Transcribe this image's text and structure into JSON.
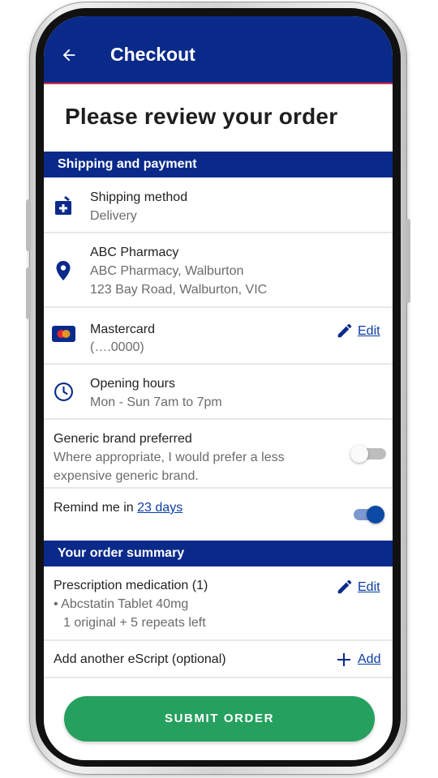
{
  "appbar": {
    "title": "Checkout"
  },
  "page": {
    "title": "Please review your order"
  },
  "sections": {
    "shipping_payment": "Shipping and payment",
    "order_summary": "Your order summary"
  },
  "shipping": {
    "title": "Shipping method",
    "value": "Delivery"
  },
  "pharmacy": {
    "name": "ABC Pharmacy",
    "line1": "ABC Pharmacy, Walburton",
    "line2": "123 Bay Road, Walburton, VIC"
  },
  "payment": {
    "card": "Mastercard",
    "number": "(….0000)",
    "edit": "Edit"
  },
  "hours": {
    "title": "Opening hours",
    "value": "Mon - Sun 7am to 7pm"
  },
  "generic": {
    "title": "Generic brand preferred",
    "line1": "Where appropriate, I would prefer a less",
    "line2": "expensive generic brand.",
    "enabled": false
  },
  "remind": {
    "prefix": "Remind me in ",
    "link": "23 days",
    "enabled": true
  },
  "prescription": {
    "title": "Prescription medication (1)",
    "item": "• Abcstatin Tablet 40mg",
    "repeats": "1 original + 5 repeats left",
    "edit": "Edit"
  },
  "escript": {
    "label": "Add another eScript (optional)",
    "add": "Add"
  },
  "submit": {
    "label": "SUBMIT ORDER"
  },
  "colors": {
    "primary": "#0a2a8a",
    "accent_red": "#d9334a",
    "success": "#26a05e",
    "link": "#0b3da0"
  }
}
